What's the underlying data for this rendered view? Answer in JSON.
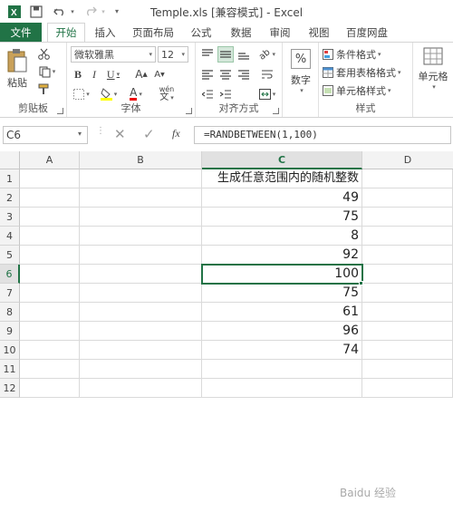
{
  "window": {
    "title": "Temple.xls [兼容模式] - Excel"
  },
  "tabs": [
    {
      "label": "文件"
    },
    {
      "label": "开始"
    },
    {
      "label": "插入"
    },
    {
      "label": "页面布局"
    },
    {
      "label": "公式"
    },
    {
      "label": "数据"
    },
    {
      "label": "审阅"
    },
    {
      "label": "视图"
    },
    {
      "label": "百度网盘"
    }
  ],
  "ribbon": {
    "clipboard": {
      "paste": "粘贴",
      "label": "剪贴板"
    },
    "font": {
      "name": "微软雅黑",
      "size": "12",
      "label": "字体",
      "wen": "wén"
    },
    "alignment": {
      "label": "对齐方式"
    },
    "number": {
      "label": "数字",
      "percent": "%"
    },
    "styles": {
      "conditional": "条件格式",
      "table": "套用表格格式",
      "cell": "单元格样式",
      "label": "样式"
    },
    "cells": {
      "label": "单元格"
    }
  },
  "formula_bar": {
    "name_box": "C6",
    "formula": "=RANDBETWEEN(1,100)",
    "fx": "fx"
  },
  "sheet": {
    "columns": [
      "A",
      "B",
      "C",
      "D"
    ],
    "rows": [
      "1",
      "2",
      "3",
      "4",
      "5",
      "6",
      "7",
      "8",
      "9",
      "10",
      "11",
      "12"
    ],
    "selected_cell": "C6",
    "c_values": [
      "生成任意范围内的随机整数",
      "49",
      "75",
      "8",
      "92",
      "100",
      "75",
      "61",
      "96",
      "74",
      "",
      ""
    ]
  },
  "watermark": {
    "text": "Baidu 经验"
  }
}
